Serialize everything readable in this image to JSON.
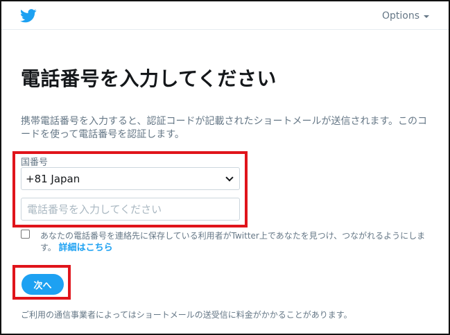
{
  "header": {
    "logo_icon": "twitter-bird-icon",
    "options_label": "Options"
  },
  "main": {
    "title": "電話番号を入力してください",
    "description": "携帯電話番号を入力すると、認証コードが記載されたショートメールが送信されます。このコードを使って電話番号を認証します。",
    "country_label": "国番号",
    "country_selected": "+81 Japan",
    "phone_placeholder": "電話番号を入力してください",
    "phone_value": "",
    "discover_checkbox_checked": false,
    "discover_text": "あなたの電話番号を連絡先に保存している利用者がTwitter上であなたを見つけ、つながれるようにします。",
    "discover_link": "詳細はこちら",
    "next_button": "次へ",
    "footer_note": "ご利用の通信事業者によってはショートメールの送受信に料金がかかることがあります。"
  },
  "colors": {
    "accent": "#1da1f2",
    "highlight": "#e0141b",
    "muted_text": "#657786"
  }
}
